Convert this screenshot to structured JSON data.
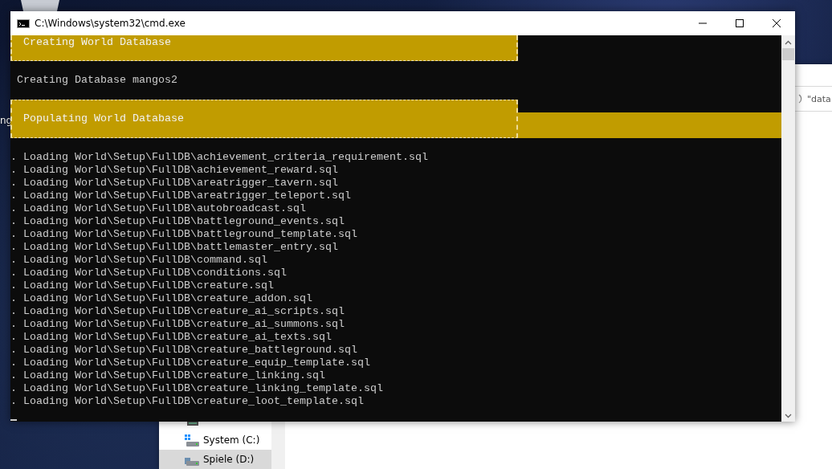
{
  "desktop": {
    "icon_label": "ng"
  },
  "explorer": {
    "search": {
      "value": "\"data"
    },
    "drives": [
      {
        "label": "System (C:)",
        "selected": false,
        "kind": "system"
      },
      {
        "label": "Spiele (D:)",
        "selected": true,
        "kind": "data"
      }
    ]
  },
  "window": {
    "title": "C:\\Windows\\system32\\cmd.exe",
    "console": [
      {
        "kind": "banner",
        "text": "Creating World Database",
        "top_cut": true,
        "full_width": false
      },
      {
        "kind": "text",
        "text": "Creating Database mangos2"
      },
      {
        "kind": "banner",
        "text": "Populating World Database",
        "top_cut": false,
        "full_width": true
      },
      {
        "kind": "text",
        "text": ". Loading World\\Setup\\FullDB\\achievement_criteria_requirement.sql"
      },
      {
        "kind": "text",
        "text": ". Loading World\\Setup\\FullDB\\achievement_reward.sql"
      },
      {
        "kind": "text",
        "text": ". Loading World\\Setup\\FullDB\\areatrigger_tavern.sql"
      },
      {
        "kind": "text",
        "text": ". Loading World\\Setup\\FullDB\\areatrigger_teleport.sql"
      },
      {
        "kind": "text",
        "text": ". Loading World\\Setup\\FullDB\\autobroadcast.sql"
      },
      {
        "kind": "text",
        "text": ". Loading World\\Setup\\FullDB\\battleground_events.sql"
      },
      {
        "kind": "text",
        "text": ". Loading World\\Setup\\FullDB\\battleground_template.sql"
      },
      {
        "kind": "text",
        "text": ". Loading World\\Setup\\FullDB\\battlemaster_entry.sql"
      },
      {
        "kind": "text",
        "text": ". Loading World\\Setup\\FullDB\\command.sql"
      },
      {
        "kind": "text",
        "text": ". Loading World\\Setup\\FullDB\\conditions.sql"
      },
      {
        "kind": "text",
        "text": ". Loading World\\Setup\\FullDB\\creature.sql"
      },
      {
        "kind": "text",
        "text": ". Loading World\\Setup\\FullDB\\creature_addon.sql"
      },
      {
        "kind": "text",
        "text": ". Loading World\\Setup\\FullDB\\creature_ai_scripts.sql"
      },
      {
        "kind": "text",
        "text": ". Loading World\\Setup\\FullDB\\creature_ai_summons.sql"
      },
      {
        "kind": "text",
        "text": ". Loading World\\Setup\\FullDB\\creature_ai_texts.sql"
      },
      {
        "kind": "text",
        "text": ". Loading World\\Setup\\FullDB\\creature_battleground.sql"
      },
      {
        "kind": "text",
        "text": ". Loading World\\Setup\\FullDB\\creature_equip_template.sql"
      },
      {
        "kind": "text",
        "text": ". Loading World\\Setup\\FullDB\\creature_linking.sql"
      },
      {
        "kind": "text",
        "text": ". Loading World\\Setup\\FullDB\\creature_linking_template.sql"
      },
      {
        "kind": "text",
        "text": ". Loading World\\Setup\\FullDB\\creature_loot_template.sql"
      }
    ]
  }
}
